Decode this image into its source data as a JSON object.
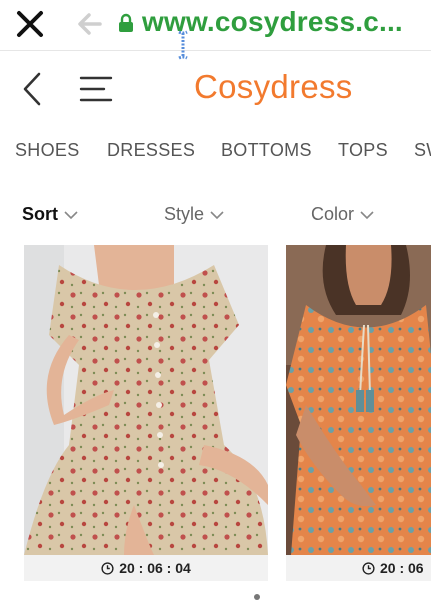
{
  "browser": {
    "url": "www.cosydress.c..."
  },
  "header": {
    "logo": "Cosydress"
  },
  "categories": [
    "SHOES",
    "DRESSES",
    "BOTTOMS",
    "TOPS",
    "SW"
  ],
  "filters": {
    "sort": "Sort",
    "style": "Style",
    "color": "Color"
  },
  "products": [
    {
      "timer": "20 : 06 : 04",
      "dress_color": "#d6c3a4",
      "print_color": "#c0504d"
    },
    {
      "timer": "20 : 06",
      "dress_color": "#e4854a",
      "print_color": "#6aa0a8"
    }
  ],
  "colors": {
    "url_green": "#2f9e3e",
    "brand_orange": "#f27a2e"
  }
}
